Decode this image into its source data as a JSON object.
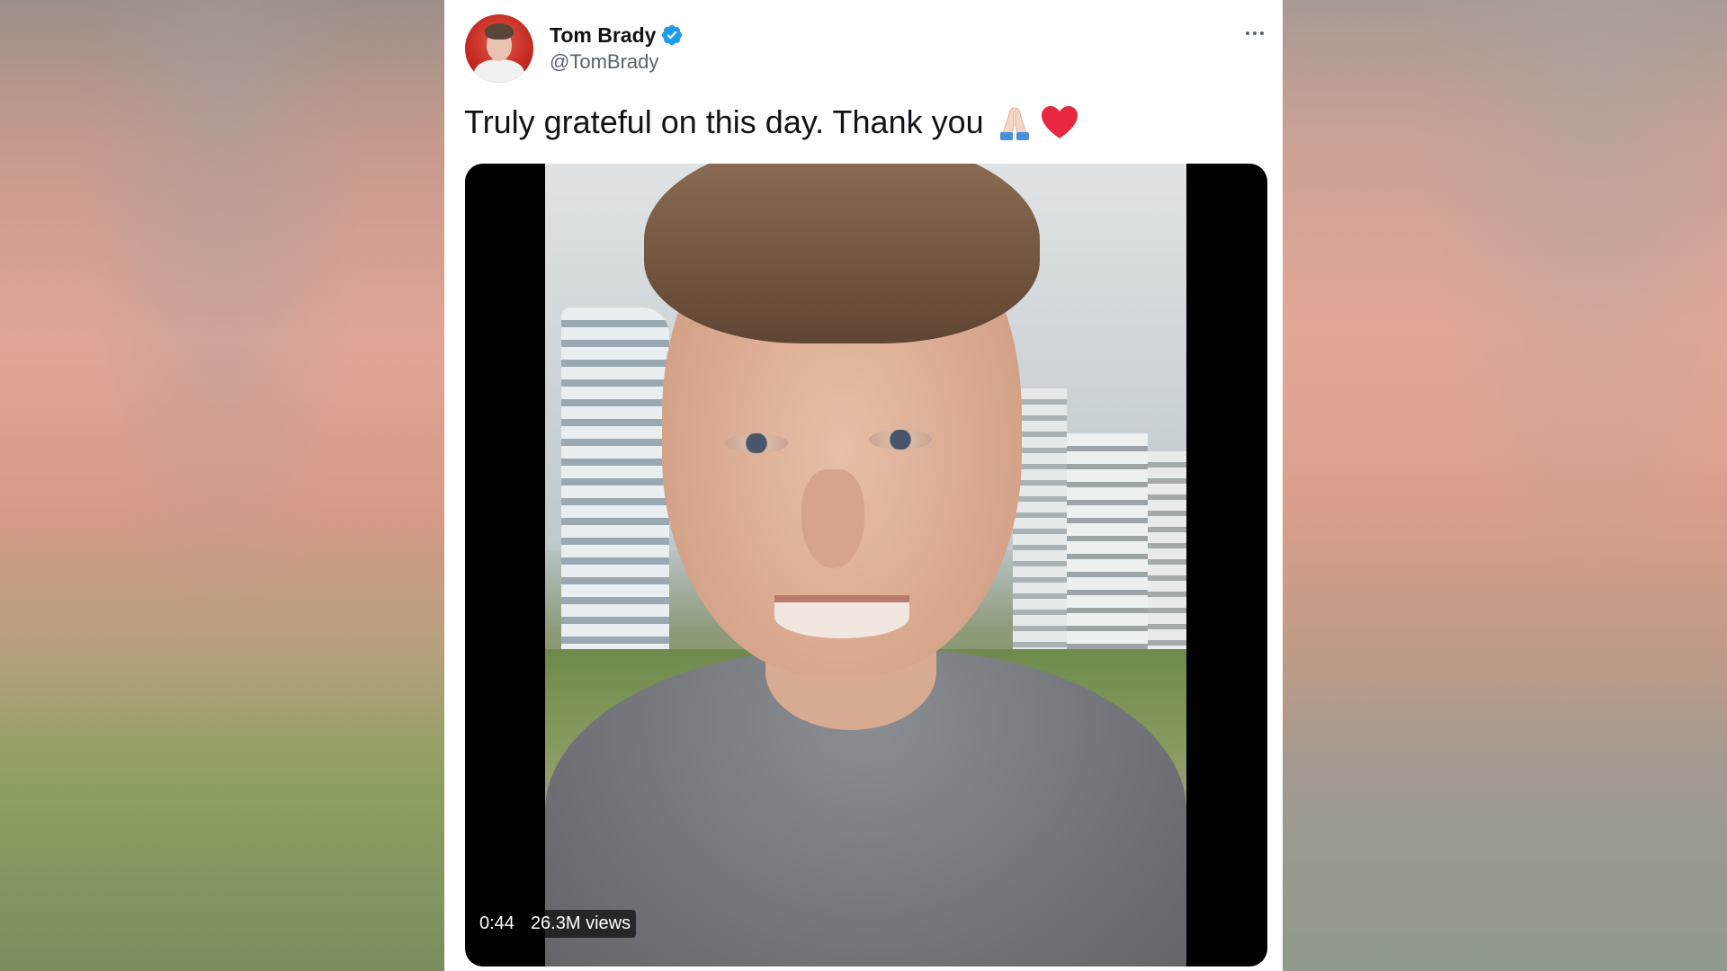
{
  "tweet": {
    "display_name": "Tom Brady",
    "handle": "@TomBrady",
    "text": "Truly grateful on this day. Thank you",
    "emojis": [
      "folded-hands-icon",
      "red-heart-icon"
    ],
    "verified": true
  },
  "media": {
    "type": "video",
    "duration": "0:44",
    "views": "26.3M views"
  },
  "colors": {
    "text_primary": "#0f1419",
    "text_secondary": "#536471",
    "verified_blue": "#1d9bf0",
    "heart_red": "#e8283e"
  }
}
